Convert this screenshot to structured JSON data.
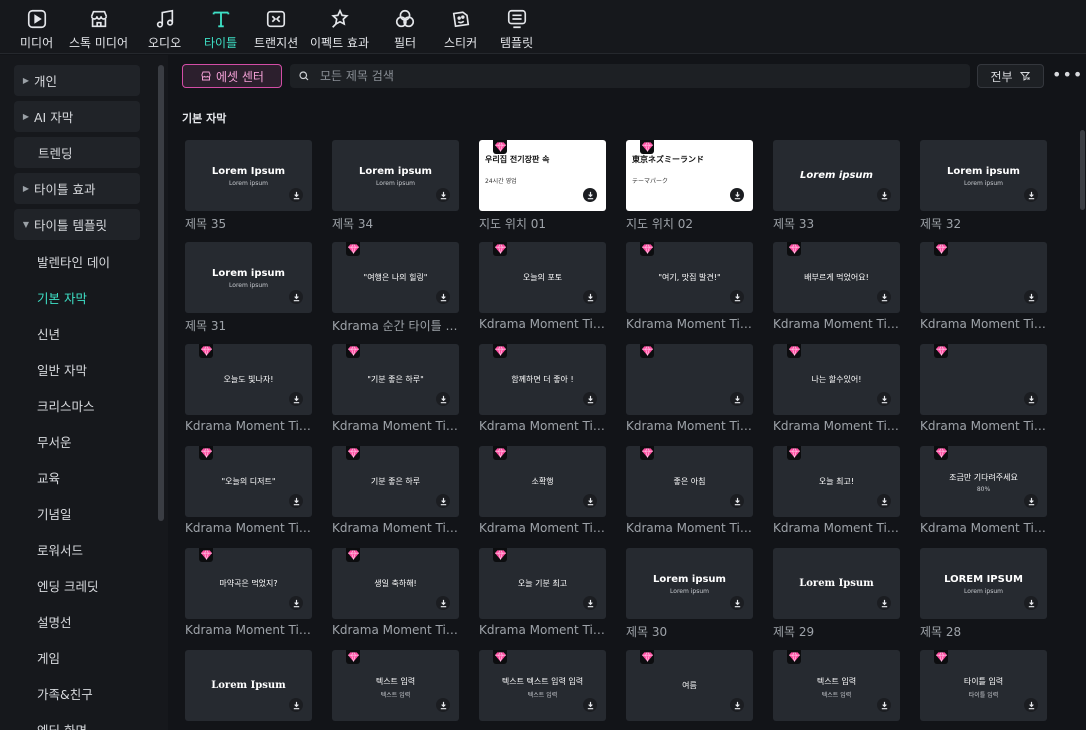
{
  "toolbar": {
    "items": [
      {
        "label": "미디어",
        "icon": "media-icon"
      },
      {
        "label": "스톡 미디어",
        "icon": "stock-media-icon"
      },
      {
        "label": "오디오",
        "icon": "audio-icon"
      },
      {
        "label": "타이틀",
        "icon": "title-icon",
        "active": true
      },
      {
        "label": "트랜지션",
        "icon": "transition-icon"
      },
      {
        "label": "이펙트 효과",
        "icon": "effects-icon"
      },
      {
        "label": "필터",
        "icon": "filter-icon"
      },
      {
        "label": "스티커",
        "icon": "sticker-icon"
      },
      {
        "label": "템플릿",
        "icon": "template-icon"
      }
    ]
  },
  "sidebar": {
    "items": [
      {
        "label": "개인",
        "expandable": true,
        "expanded": false
      },
      {
        "label": "AI 자막",
        "expandable": true,
        "expanded": false
      },
      {
        "label": "트렌딩",
        "expandable": false
      },
      {
        "label": "타이틀 효과",
        "expandable": true,
        "expanded": false
      },
      {
        "label": "타이틀 템플릿",
        "expandable": true,
        "expanded": true
      }
    ],
    "subitems": [
      "발렌타인 데이",
      "기본 자막",
      "신년",
      "일반 자막",
      "크리스마스",
      "무서운",
      "교육",
      "기념일",
      "로워서드",
      "엔딩 크레딧",
      "설명선",
      "게임",
      "가족&친구",
      "엔딩 화면"
    ],
    "active_subitem": "기본 자막"
  },
  "main": {
    "asset_center_label": "에셋 센터",
    "search_placeholder": "모든 제목 검색",
    "filter_label": "전부",
    "more_label": "•••",
    "section_title": "기본 자막"
  },
  "cards": [
    {
      "label": "제목 35",
      "text": "Lorem Ipsum",
      "sub": "Lorem ipsum",
      "premium": false
    },
    {
      "label": "제목 34",
      "text": "Lorem ipsum",
      "sub": "Lorem ipsum",
      "premium": false
    },
    {
      "label": "지도 위치 01",
      "text": "우리집 전기장판 속",
      "sub": "24시간 영업",
      "premium": true,
      "map": true
    },
    {
      "label": "지도 위치 02",
      "text": "東京ネズミーランド",
      "sub": "テーマパーク",
      "premium": true,
      "map": true
    },
    {
      "label": "제목 33",
      "text": "Lorem ipsum",
      "premium": false
    },
    {
      "label": "제목 32",
      "text": "Lorem ipsum",
      "sub": "Lorem ipsum",
      "premium": false
    },
    {
      "label": "제목 31",
      "text": "Lorem ipsum",
      "sub": "Lorem ipsum",
      "premium": false
    },
    {
      "label": "Kdrama 순간 타이틀 02",
      "text": "\"여행은 나의 힐링\"",
      "premium": true
    },
    {
      "label": "Kdrama Moment Title...",
      "text": "오늘의 포토",
      "premium": true
    },
    {
      "label": "Kdrama Moment Title...",
      "text": "\"여기, 맛집 발견!\"",
      "premium": true
    },
    {
      "label": "Kdrama Moment Title...",
      "text": "배부르게 먹었어요!",
      "premium": true
    },
    {
      "label": "Kdrama Moment Title...",
      "text": "",
      "premium": true
    },
    {
      "label": "Kdrama Moment Title...",
      "text": "오늘도 빛나자!",
      "premium": true
    },
    {
      "label": "Kdrama Moment Title...",
      "text": "\"기분 좋은 하루\"",
      "premium": true
    },
    {
      "label": "Kdrama Moment Title...",
      "text": "함께하면 더 좋아 !",
      "premium": true
    },
    {
      "label": "Kdrama Moment Title...",
      "text": "",
      "premium": true
    },
    {
      "label": "Kdrama Moment Title...",
      "text": "나는 할수있어!",
      "premium": true
    },
    {
      "label": "Kdrama Moment Title...",
      "text": "",
      "premium": true
    },
    {
      "label": "Kdrama Moment Title...",
      "text": "\"오늘의 디저트\"",
      "premium": true
    },
    {
      "label": "Kdrama Moment Title...",
      "text": "기분 좋은 하루",
      "premium": true
    },
    {
      "label": "Kdrama Moment Title...",
      "text": "소확행",
      "premium": true
    },
    {
      "label": "Kdrama Moment Title...",
      "text": "좋은 아침",
      "premium": true
    },
    {
      "label": "Kdrama Moment Title...",
      "text": "오늘 최고!",
      "premium": true
    },
    {
      "label": "Kdrama Moment Title...",
      "text": "조금만 기다려주세요",
      "sub": "80%",
      "premium": true
    },
    {
      "label": "Kdrama Moment Title...",
      "text": "마약곡은 먹었지?",
      "premium": true
    },
    {
      "label": "Kdrama Moment Title...",
      "text": "생일 축하해!",
      "premium": true
    },
    {
      "label": "Kdrama Moment Title...",
      "text": "오늘 기분 최고",
      "premium": true
    },
    {
      "label": "제목 30",
      "text": "Lorem ipsum",
      "sub": "Lorem ipsum",
      "premium": false
    },
    {
      "label": "제목 29",
      "text": "Lorem Ipsum",
      "premium": false
    },
    {
      "label": "제목 28",
      "text": "LOREM IPSUM",
      "sub": "Lorem ipsum",
      "premium": false
    },
    {
      "label": "",
      "text": "Lorem Ipsum",
      "premium": false
    },
    {
      "label": "",
      "text": "텍스트 입력",
      "sub": "텍스트 입력",
      "premium": true
    },
    {
      "label": "",
      "text": "텍스트 텍스트 입력 입력",
      "sub": "텍스트 입력",
      "premium": true
    },
    {
      "label": "",
      "text": "여름",
      "premium": true
    },
    {
      "label": "",
      "text": "텍스트 입력",
      "sub": "텍스트 입력",
      "premium": true
    },
    {
      "label": "",
      "text": "타이틀 입력",
      "sub": "타이틀 입력",
      "premium": true
    }
  ]
}
